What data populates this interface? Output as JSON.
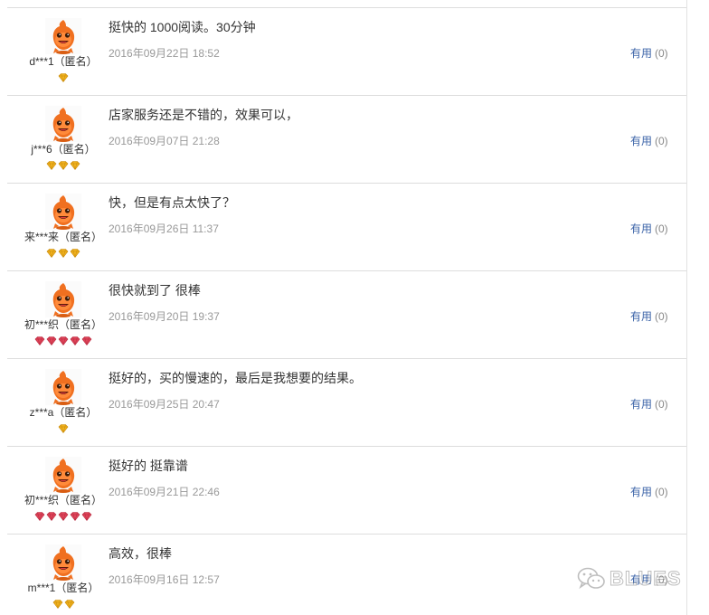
{
  "reviews": [
    {
      "nick": "d***1（匿名）",
      "content": "挺快的 1000阅读。30分钟",
      "time": "2016年09月22日 18:52",
      "useful_label": "有用",
      "useful_count": "(0)",
      "badge_type": "gold",
      "badge_count": 1
    },
    {
      "nick": "j***6（匿名）",
      "content": "店家服务还是不错的，效果可以，",
      "time": "2016年09月07日 21:28",
      "useful_label": "有用",
      "useful_count": "(0)",
      "badge_type": "gold",
      "badge_count": 3
    },
    {
      "nick": "来***来（匿名）",
      "content": "快，但是有点太快了？",
      "time": "2016年09月26日 11:37",
      "useful_label": "有用",
      "useful_count": "(0)",
      "badge_type": "gold",
      "badge_count": 3
    },
    {
      "nick": "初***织（匿名）",
      "content": "很快就到了 很棒",
      "time": "2016年09月20日 19:37",
      "useful_label": "有用",
      "useful_count": "(0)",
      "badge_type": "red",
      "badge_count": 5
    },
    {
      "nick": "z***a（匿名）",
      "content": "挺好的，买的慢速的，最后是我想要的结果。",
      "time": "2016年09月25日 20:47",
      "useful_label": "有用",
      "useful_count": "(0)",
      "badge_type": "gold",
      "badge_count": 1
    },
    {
      "nick": "初***织（匿名）",
      "content": "挺好的 挺靠谱",
      "time": "2016年09月21日 22:46",
      "useful_label": "有用",
      "useful_count": "(0)",
      "badge_type": "red",
      "badge_count": 5
    },
    {
      "nick": "m***1（匿名）",
      "content": "高效，很棒",
      "time": "2016年09月16日 12:57",
      "useful_label": "有用",
      "useful_count": "(0)",
      "badge_type": "gold",
      "badge_count": 2
    }
  ],
  "watermark": {
    "text": "BLUES",
    "icon": "wechat-icon"
  },
  "colors": {
    "link": "#3c64a8",
    "time": "#999999",
    "badge_gold": "#f0b21e",
    "badge_red": "#e0455a",
    "avatar_orange": "#f07020"
  }
}
